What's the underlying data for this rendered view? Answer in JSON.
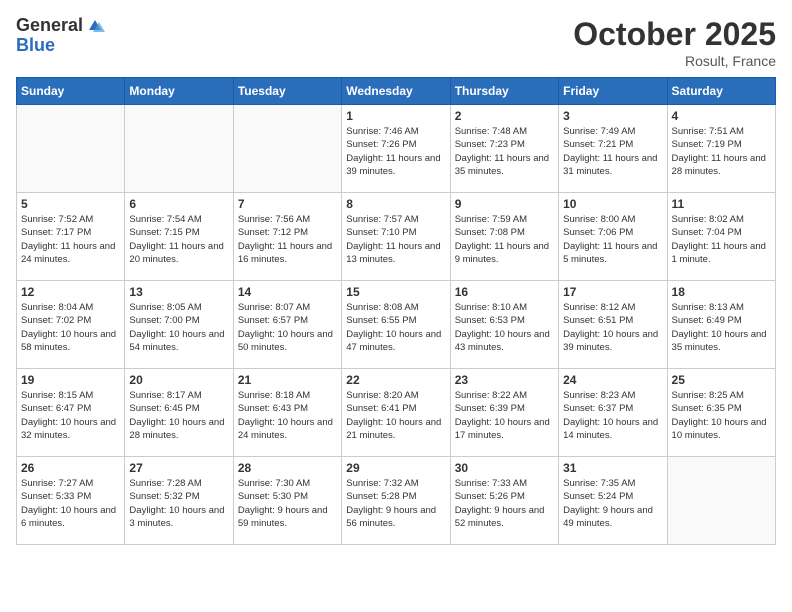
{
  "header": {
    "logo_line1": "General",
    "logo_line2": "Blue",
    "month": "October 2025",
    "location": "Rosult, France"
  },
  "weekdays": [
    "Sunday",
    "Monday",
    "Tuesday",
    "Wednesday",
    "Thursday",
    "Friday",
    "Saturday"
  ],
  "weeks": [
    [
      {
        "day": "",
        "sunrise": "",
        "sunset": "",
        "daylight": ""
      },
      {
        "day": "",
        "sunrise": "",
        "sunset": "",
        "daylight": ""
      },
      {
        "day": "",
        "sunrise": "",
        "sunset": "",
        "daylight": ""
      },
      {
        "day": "1",
        "sunrise": "Sunrise: 7:46 AM",
        "sunset": "Sunset: 7:26 PM",
        "daylight": "Daylight: 11 hours and 39 minutes."
      },
      {
        "day": "2",
        "sunrise": "Sunrise: 7:48 AM",
        "sunset": "Sunset: 7:23 PM",
        "daylight": "Daylight: 11 hours and 35 minutes."
      },
      {
        "day": "3",
        "sunrise": "Sunrise: 7:49 AM",
        "sunset": "Sunset: 7:21 PM",
        "daylight": "Daylight: 11 hours and 31 minutes."
      },
      {
        "day": "4",
        "sunrise": "Sunrise: 7:51 AM",
        "sunset": "Sunset: 7:19 PM",
        "daylight": "Daylight: 11 hours and 28 minutes."
      }
    ],
    [
      {
        "day": "5",
        "sunrise": "Sunrise: 7:52 AM",
        "sunset": "Sunset: 7:17 PM",
        "daylight": "Daylight: 11 hours and 24 minutes."
      },
      {
        "day": "6",
        "sunrise": "Sunrise: 7:54 AM",
        "sunset": "Sunset: 7:15 PM",
        "daylight": "Daylight: 11 hours and 20 minutes."
      },
      {
        "day": "7",
        "sunrise": "Sunrise: 7:56 AM",
        "sunset": "Sunset: 7:12 PM",
        "daylight": "Daylight: 11 hours and 16 minutes."
      },
      {
        "day": "8",
        "sunrise": "Sunrise: 7:57 AM",
        "sunset": "Sunset: 7:10 PM",
        "daylight": "Daylight: 11 hours and 13 minutes."
      },
      {
        "day": "9",
        "sunrise": "Sunrise: 7:59 AM",
        "sunset": "Sunset: 7:08 PM",
        "daylight": "Daylight: 11 hours and 9 minutes."
      },
      {
        "day": "10",
        "sunrise": "Sunrise: 8:00 AM",
        "sunset": "Sunset: 7:06 PM",
        "daylight": "Daylight: 11 hours and 5 minutes."
      },
      {
        "day": "11",
        "sunrise": "Sunrise: 8:02 AM",
        "sunset": "Sunset: 7:04 PM",
        "daylight": "Daylight: 11 hours and 1 minute."
      }
    ],
    [
      {
        "day": "12",
        "sunrise": "Sunrise: 8:04 AM",
        "sunset": "Sunset: 7:02 PM",
        "daylight": "Daylight: 10 hours and 58 minutes."
      },
      {
        "day": "13",
        "sunrise": "Sunrise: 8:05 AM",
        "sunset": "Sunset: 7:00 PM",
        "daylight": "Daylight: 10 hours and 54 minutes."
      },
      {
        "day": "14",
        "sunrise": "Sunrise: 8:07 AM",
        "sunset": "Sunset: 6:57 PM",
        "daylight": "Daylight: 10 hours and 50 minutes."
      },
      {
        "day": "15",
        "sunrise": "Sunrise: 8:08 AM",
        "sunset": "Sunset: 6:55 PM",
        "daylight": "Daylight: 10 hours and 47 minutes."
      },
      {
        "day": "16",
        "sunrise": "Sunrise: 8:10 AM",
        "sunset": "Sunset: 6:53 PM",
        "daylight": "Daylight: 10 hours and 43 minutes."
      },
      {
        "day": "17",
        "sunrise": "Sunrise: 8:12 AM",
        "sunset": "Sunset: 6:51 PM",
        "daylight": "Daylight: 10 hours and 39 minutes."
      },
      {
        "day": "18",
        "sunrise": "Sunrise: 8:13 AM",
        "sunset": "Sunset: 6:49 PM",
        "daylight": "Daylight: 10 hours and 35 minutes."
      }
    ],
    [
      {
        "day": "19",
        "sunrise": "Sunrise: 8:15 AM",
        "sunset": "Sunset: 6:47 PM",
        "daylight": "Daylight: 10 hours and 32 minutes."
      },
      {
        "day": "20",
        "sunrise": "Sunrise: 8:17 AM",
        "sunset": "Sunset: 6:45 PM",
        "daylight": "Daylight: 10 hours and 28 minutes."
      },
      {
        "day": "21",
        "sunrise": "Sunrise: 8:18 AM",
        "sunset": "Sunset: 6:43 PM",
        "daylight": "Daylight: 10 hours and 24 minutes."
      },
      {
        "day": "22",
        "sunrise": "Sunrise: 8:20 AM",
        "sunset": "Sunset: 6:41 PM",
        "daylight": "Daylight: 10 hours and 21 minutes."
      },
      {
        "day": "23",
        "sunrise": "Sunrise: 8:22 AM",
        "sunset": "Sunset: 6:39 PM",
        "daylight": "Daylight: 10 hours and 17 minutes."
      },
      {
        "day": "24",
        "sunrise": "Sunrise: 8:23 AM",
        "sunset": "Sunset: 6:37 PM",
        "daylight": "Daylight: 10 hours and 14 minutes."
      },
      {
        "day": "25",
        "sunrise": "Sunrise: 8:25 AM",
        "sunset": "Sunset: 6:35 PM",
        "daylight": "Daylight: 10 hours and 10 minutes."
      }
    ],
    [
      {
        "day": "26",
        "sunrise": "Sunrise: 7:27 AM",
        "sunset": "Sunset: 5:33 PM",
        "daylight": "Daylight: 10 hours and 6 minutes."
      },
      {
        "day": "27",
        "sunrise": "Sunrise: 7:28 AM",
        "sunset": "Sunset: 5:32 PM",
        "daylight": "Daylight: 10 hours and 3 minutes."
      },
      {
        "day": "28",
        "sunrise": "Sunrise: 7:30 AM",
        "sunset": "Sunset: 5:30 PM",
        "daylight": "Daylight: 9 hours and 59 minutes."
      },
      {
        "day": "29",
        "sunrise": "Sunrise: 7:32 AM",
        "sunset": "Sunset: 5:28 PM",
        "daylight": "Daylight: 9 hours and 56 minutes."
      },
      {
        "day": "30",
        "sunrise": "Sunrise: 7:33 AM",
        "sunset": "Sunset: 5:26 PM",
        "daylight": "Daylight: 9 hours and 52 minutes."
      },
      {
        "day": "31",
        "sunrise": "Sunrise: 7:35 AM",
        "sunset": "Sunset: 5:24 PM",
        "daylight": "Daylight: 9 hours and 49 minutes."
      },
      {
        "day": "",
        "sunrise": "",
        "sunset": "",
        "daylight": ""
      }
    ]
  ]
}
